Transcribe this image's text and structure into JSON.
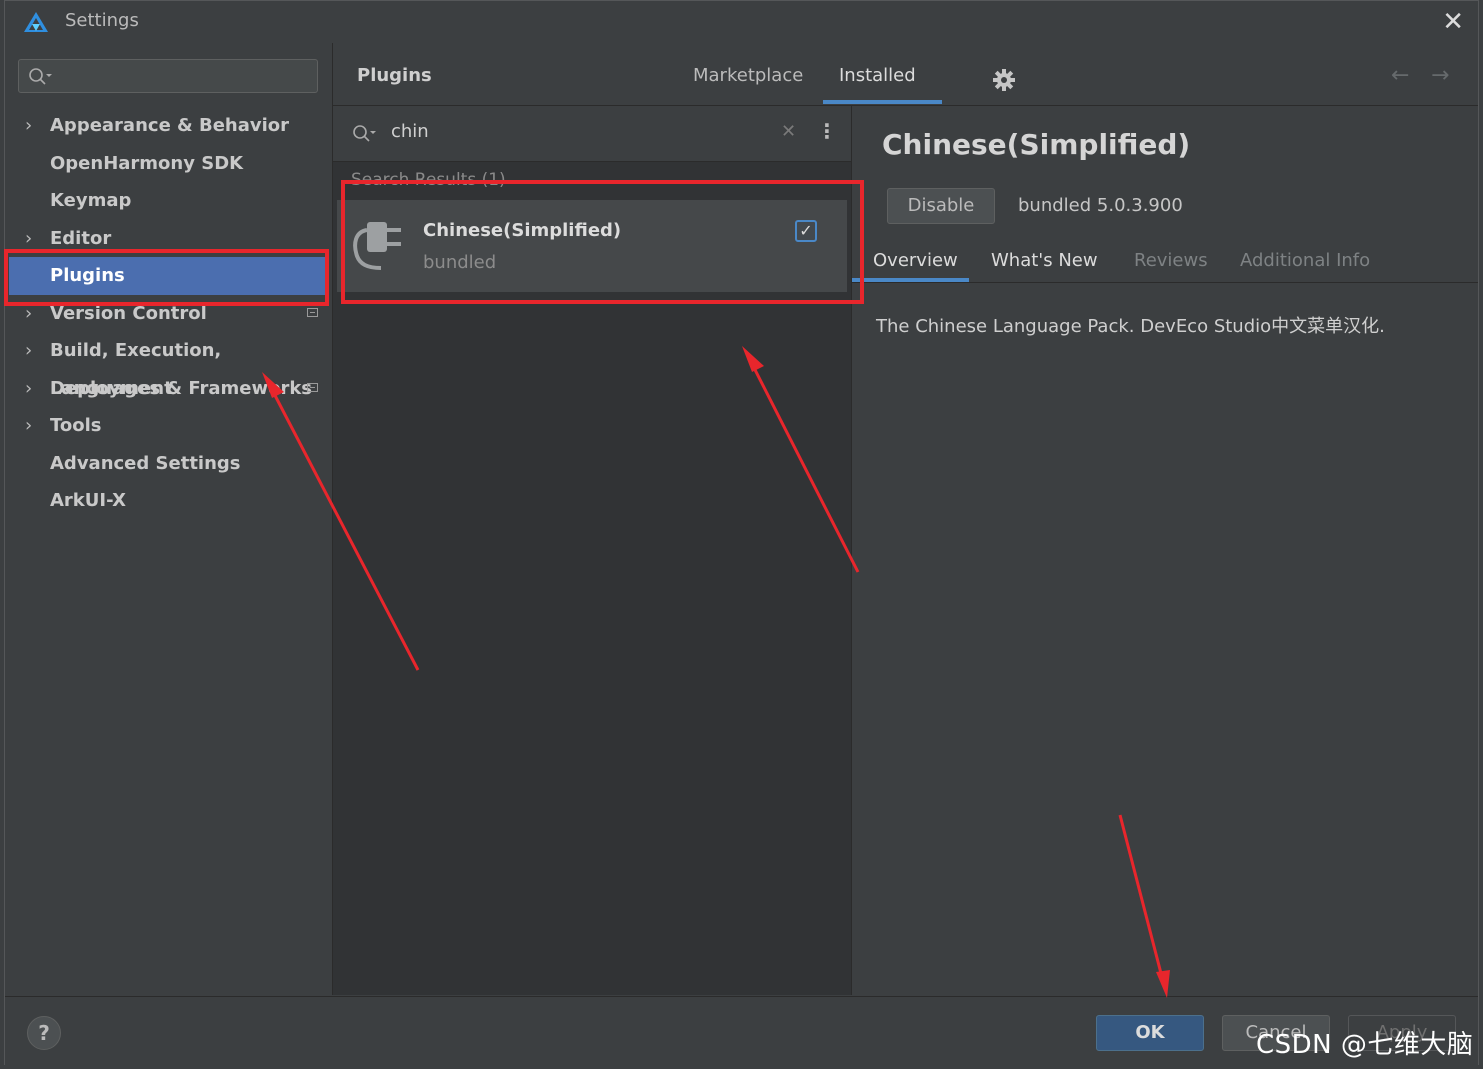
{
  "window": {
    "title": "Settings",
    "close_glyph": "✕"
  },
  "sidebar": {
    "search_placeholder": "",
    "items": [
      {
        "label": "Appearance & Behavior",
        "chevron": "›",
        "expandable": true,
        "badge": false
      },
      {
        "label": "OpenHarmony SDK",
        "chevron": "",
        "expandable": false,
        "badge": false
      },
      {
        "label": "Keymap",
        "chevron": "",
        "expandable": false,
        "badge": false
      },
      {
        "label": "Editor",
        "chevron": "›",
        "expandable": true,
        "badge": false
      },
      {
        "label": "Plugins",
        "chevron": "",
        "expandable": false,
        "badge": false,
        "selected": true
      },
      {
        "label": "Version Control",
        "chevron": "›",
        "expandable": true,
        "badge": true
      },
      {
        "label": "Build, Execution, Deployment",
        "chevron": "›",
        "expandable": true,
        "badge": false
      },
      {
        "label": "Languages & Frameworks",
        "chevron": "›",
        "expandable": true,
        "badge": true
      },
      {
        "label": "Tools",
        "chevron": "›",
        "expandable": true,
        "badge": false
      },
      {
        "label": "Advanced Settings",
        "chevron": "",
        "expandable": false,
        "badge": false
      },
      {
        "label": "ArkUI-X",
        "chevron": "",
        "expandable": false,
        "badge": false
      }
    ]
  },
  "plugins": {
    "title": "Plugins",
    "tabs": {
      "marketplace": "Marketplace",
      "installed": "Installed",
      "active": "Installed"
    },
    "nav": {
      "back": "←",
      "forward": "→"
    },
    "search": {
      "query": "chin",
      "clear_glyph": "✕",
      "menu_glyph": "⋮"
    },
    "results_label": "Search Results (1)",
    "result": {
      "name": "Chinese(Simplified)",
      "subtitle": "bundled",
      "enabled": true,
      "check_glyph": "✓"
    }
  },
  "detail": {
    "title": "Chinese(Simplified)",
    "disable_label": "Disable",
    "version": "bundled 5.0.3.900",
    "tabs": {
      "overview": "Overview",
      "whats_new": "What's New",
      "reviews": "Reviews",
      "additional_info": "Additional Info"
    },
    "description": "The Chinese Language Pack. DevEco Studio中文菜单汉化."
  },
  "footer": {
    "help": "?",
    "ok": "OK",
    "cancel": "Cancel",
    "apply": "Apply"
  },
  "watermark": "CSDN @七维大脑",
  "colors": {
    "accent": "#4a88c7",
    "selection": "#4b6eaf",
    "annotation": "#e8262c"
  },
  "icons": [
    "app-logo-icon",
    "search-icon",
    "gear-icon",
    "plug-icon",
    "checkbox-check-icon",
    "close-icon",
    "help-icon"
  ]
}
